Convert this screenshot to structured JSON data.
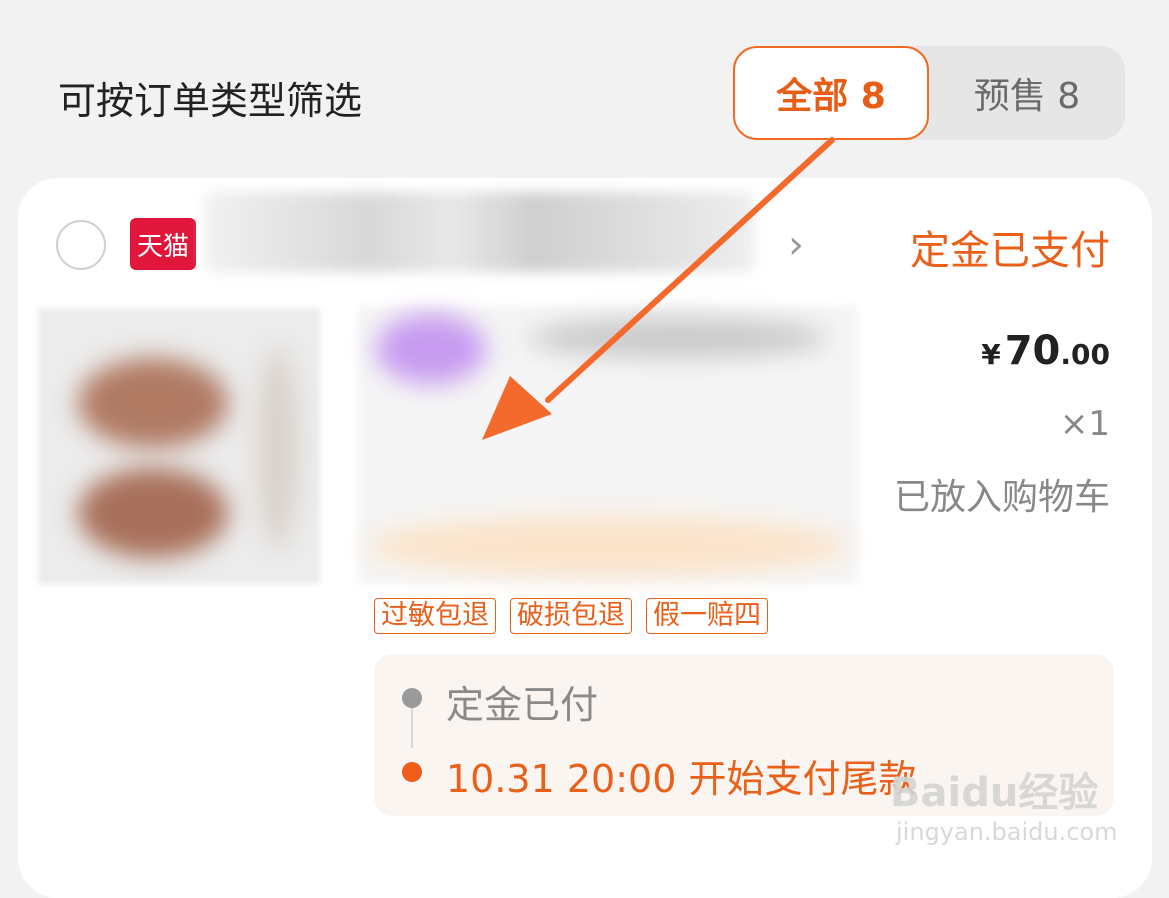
{
  "filter": {
    "title": "可按订单类型筛选",
    "tabs": [
      {
        "label": "全部 8",
        "active": true
      },
      {
        "label": "预售 8",
        "active": false
      }
    ]
  },
  "order": {
    "platform_badge": "天猫",
    "status": "定金已支付",
    "price": {
      "currency": "¥",
      "integer": "70",
      "decimal": ".00"
    },
    "quantity": "×1",
    "cart_status": "已放入购物车",
    "tags": [
      "过敏包退",
      "破损包退",
      "假一赔四"
    ],
    "timeline": [
      {
        "text": "定金已付"
      },
      {
        "text": "10.31 20:00 开始支付尾款"
      }
    ]
  },
  "watermark": {
    "main": "Baidu经验",
    "sub": "jingyan.baidu.com"
  },
  "colors": {
    "accent": "#e8601a",
    "tmall_red": "#e0163a"
  }
}
